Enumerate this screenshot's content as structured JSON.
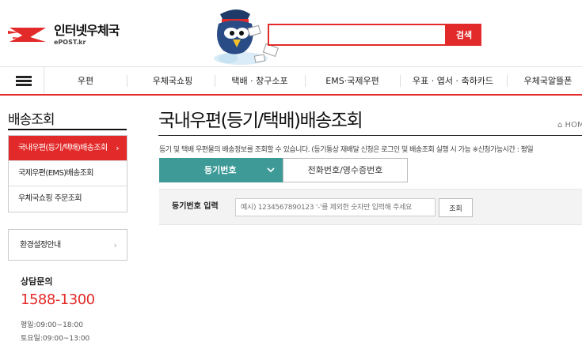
{
  "header": {
    "logo_title": "인터넷우체국",
    "logo_sub": "ePOST.kr",
    "search_placeholder": "",
    "search_button": "검색",
    "brand_red": "#e32a2a"
  },
  "nav": {
    "items": [
      "우편",
      "우체국쇼핑",
      "택배 · 창구소포",
      "EMS·국제우편",
      "우표 · 엽서 · 축하카드",
      "우체국알뜰폰"
    ]
  },
  "sidebar": {
    "title": "배송조회",
    "items": [
      {
        "label": "국내우편(등기/택배)배송조회",
        "active": true
      },
      {
        "label": "국제우편(EMS)배송조회",
        "active": false
      },
      {
        "label": "우체국쇼핑 주문조회",
        "active": false
      }
    ],
    "env_label": "환경설정안내",
    "cs_title": "상담문의",
    "cs_phone": "1588-1300",
    "cs_weekday": "평일:09:00~18:00",
    "cs_saturday": "토요일:09:00~13:00"
  },
  "main": {
    "title": "국내우편(등기/택배)배송조회",
    "crumb": "HOME",
    "notice": "등기 및 택배 우편물의 배송정보를 조회할 수 있습니다. (등기통상 재배달 신청은 로그인 및 배송조회 실행 시 가능 ※신청가능시간 : 평일",
    "tabs": {
      "active": "등기번호",
      "inactive": "전화번호/영수증번호"
    },
    "form": {
      "label": "등기번호 입력",
      "placeholder": "예시) 1234567890123 '-'를 제외한 숫자만 입력해 주세요",
      "button": "조회"
    },
    "accent_teal": "#3d9a97"
  }
}
